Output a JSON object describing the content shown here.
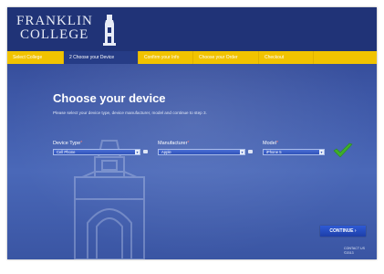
{
  "logo": {
    "line1": "FRANKLIN",
    "line2": "COLLEGE"
  },
  "nav": {
    "items": [
      {
        "label": "Select College",
        "active": false
      },
      {
        "label": "2 Choose your Device",
        "active": true
      },
      {
        "label": "Confirm your Info",
        "active": false
      },
      {
        "label": "Choose your Order",
        "active": false
      },
      {
        "label": "Checkout",
        "active": false
      }
    ]
  },
  "page": {
    "title": "Choose your device",
    "instructions": "Please select your device type, device manufacturer, model and continue to step 3."
  },
  "fields": {
    "device_type": {
      "label": "Device Type",
      "value": "Cell Phone"
    },
    "manufacturer": {
      "label": "Manufacturer",
      "value": "Apple"
    },
    "model": {
      "label": "Model",
      "value": "iPhone 5"
    },
    "required_marker": "*"
  },
  "actions": {
    "continue_label": "CONTINUE ›"
  },
  "footer": {
    "line1": "CONTACT US",
    "line2": "©2013"
  },
  "colors": {
    "header_bg": "#203377",
    "nav_bg": "#f1c300",
    "accent_check": "#3fae2a"
  }
}
